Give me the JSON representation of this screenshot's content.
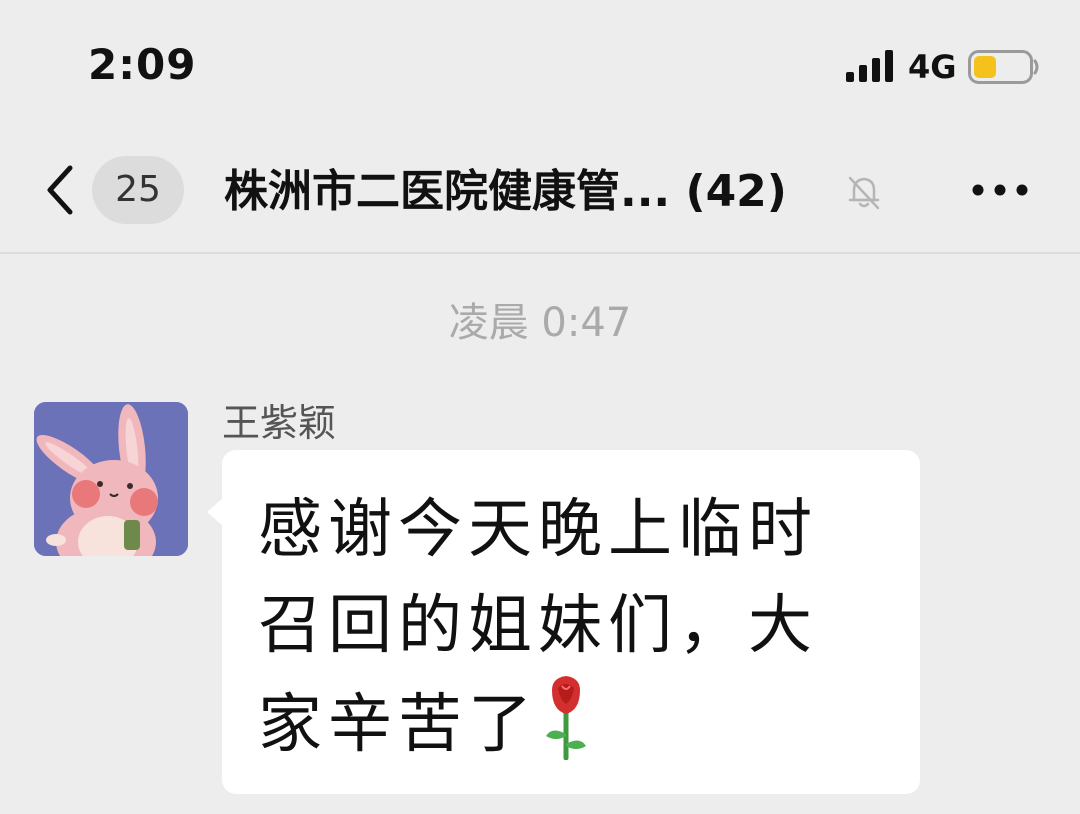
{
  "status_bar": {
    "time": "2:09",
    "network": "4G",
    "icons": [
      "signal-icon",
      "battery-icon"
    ],
    "battery_color": "#f5c21b"
  },
  "nav": {
    "back_icon": "chevron-left-icon",
    "unread_count": "25",
    "title": "株洲市二医院健康管... (42)",
    "mute_icon": "bell-muted-icon",
    "more_icon": "more-dots-icon"
  },
  "chat": {
    "timestamp": "凌晨 0:47",
    "messages": [
      {
        "sender": "王紫颖",
        "avatar": "bunny-avatar",
        "text": "感谢今天晚上临时召回的姐妹们，大家辛苦了",
        "emoji": "rose-icon"
      }
    ]
  },
  "colors": {
    "background": "#ededed",
    "bubble": "#ffffff",
    "timestamp_text": "#aaaaaa",
    "avatar_bg": "#6b72b8"
  }
}
